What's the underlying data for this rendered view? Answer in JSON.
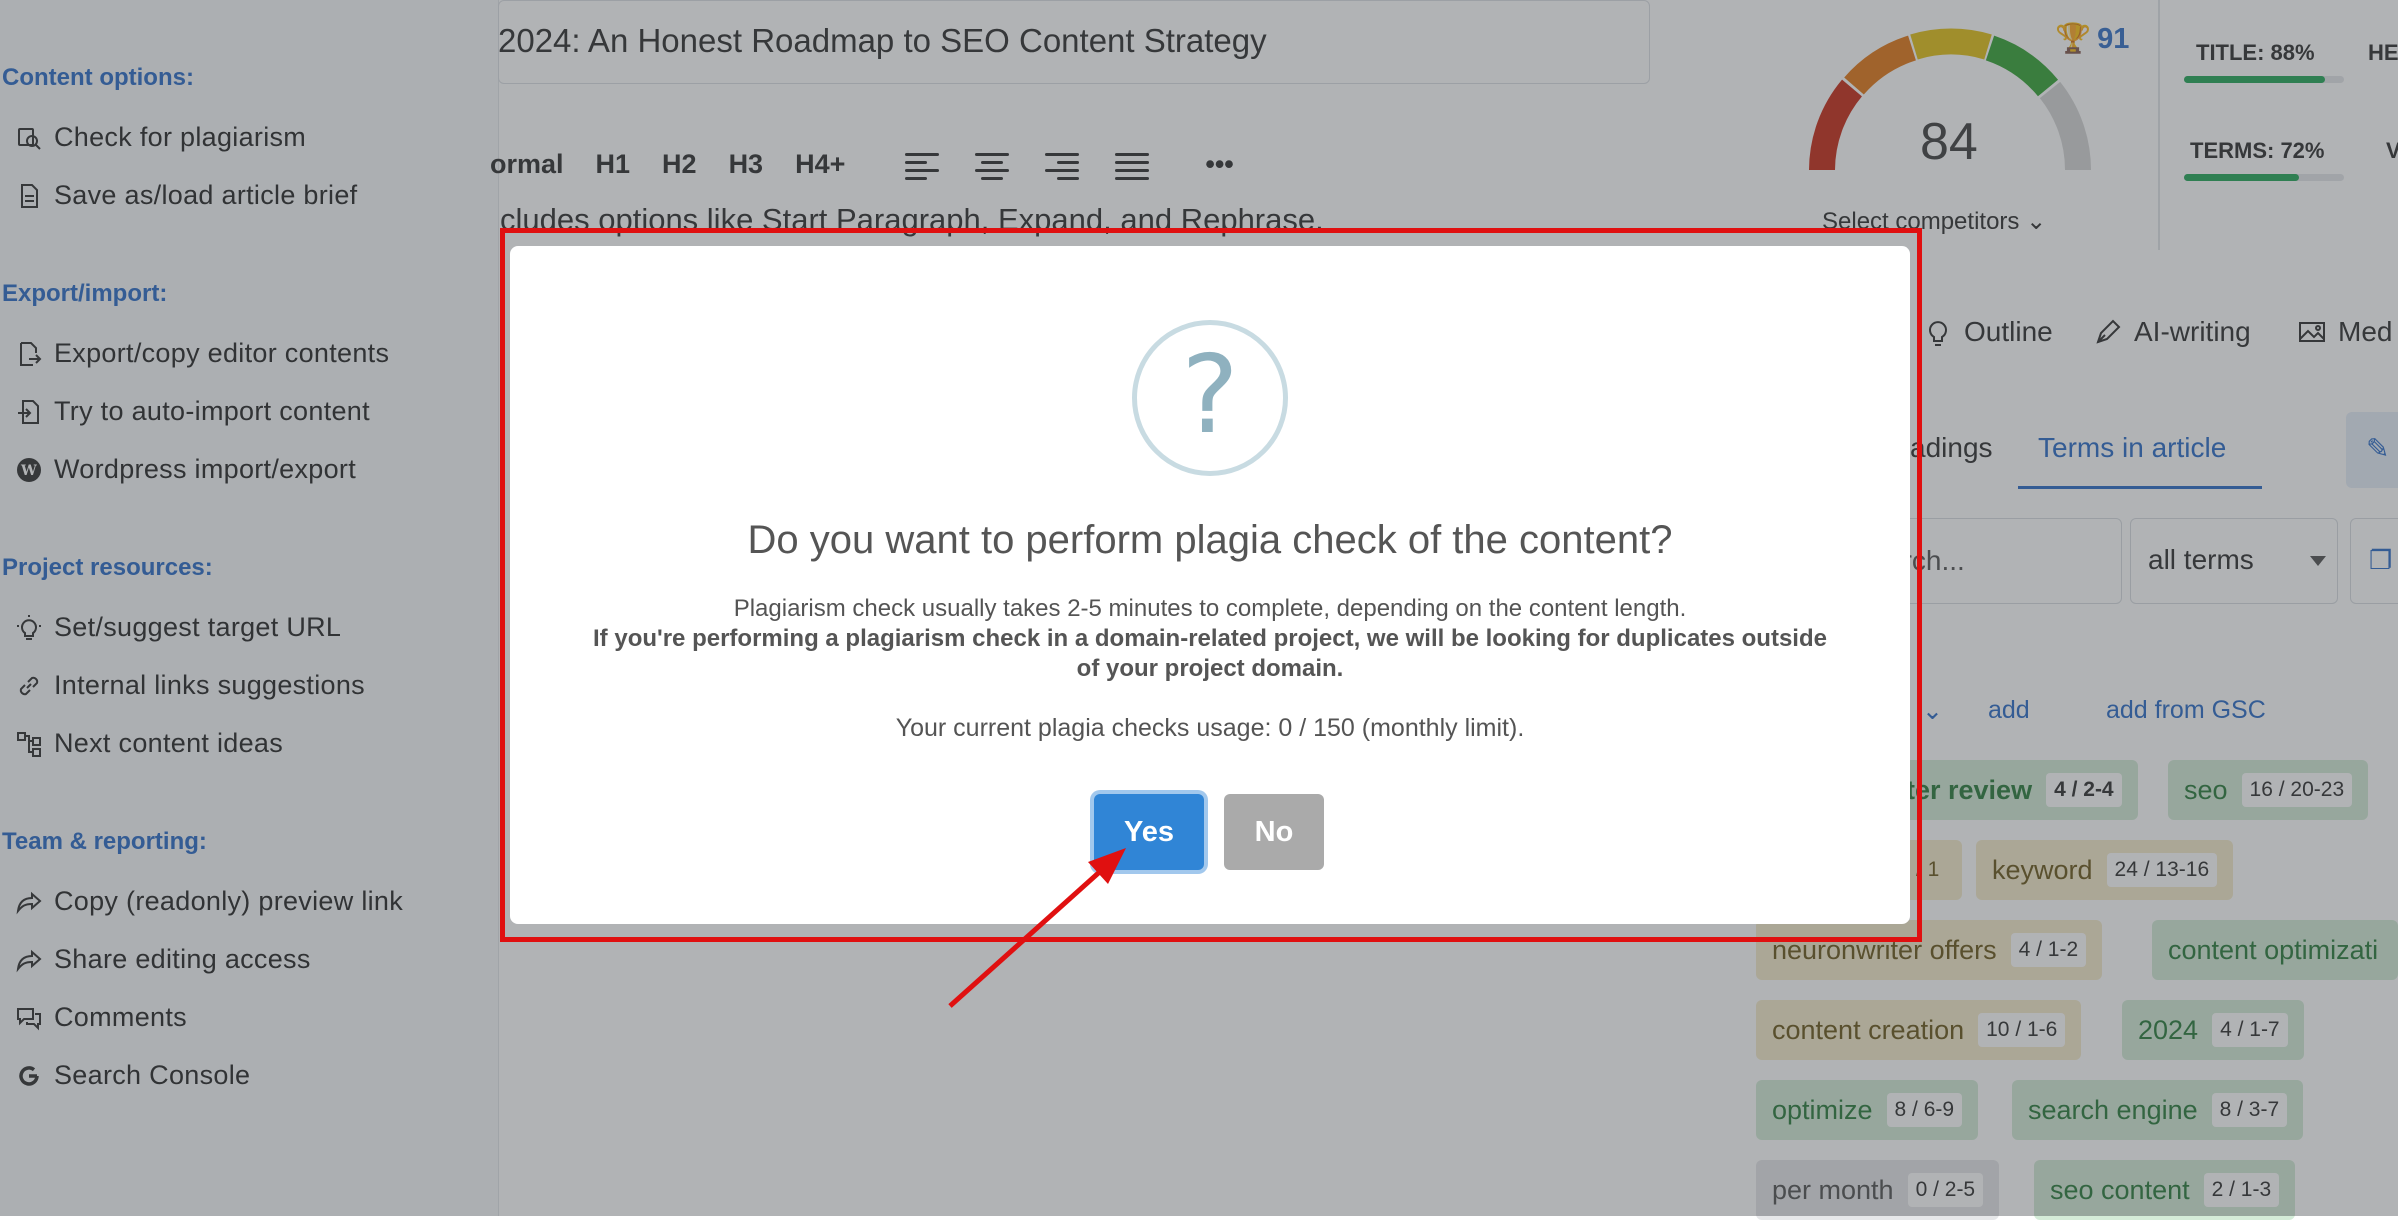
{
  "sidebar": {
    "sections": [
      {
        "heading": "Content options:",
        "items": [
          "Check for plagiarism",
          "Save as/load article brief"
        ]
      },
      {
        "heading": "Export/import:",
        "items": [
          "Export/copy editor contents",
          "Try to auto-import content",
          "Wordpress import/export"
        ]
      },
      {
        "heading": "Project resources:",
        "items": [
          "Set/suggest target URL",
          "Internal links suggestions",
          "Next content ideas"
        ]
      },
      {
        "heading": "Team & reporting:",
        "items": [
          "Copy (readonly) preview link",
          "Share editing access",
          "Comments",
          "Search Console"
        ]
      }
    ]
  },
  "editor": {
    "title": "2024: An Honest Roadmap to SEO Content Strategy",
    "toolbar": {
      "normal": "ormal",
      "h1": "H1",
      "h2": "H2",
      "h3": "H3",
      "h4": "H4+",
      "more": "•••"
    },
    "line": "cludes options like Start Paragraph, Expand, and Rephrase."
  },
  "score": {
    "value": "84",
    "trophy": "91",
    "select_competitors": "Select competitors",
    "title_metric": "TITLE: 88%",
    "title_pct": 88,
    "terms_metric": "TERMS: 72%",
    "terms_pct": 72,
    "he_metric": "HE",
    "v_metric": "V"
  },
  "panel": {
    "tabs": {
      "outline": "Outline",
      "ai_writing": "AI-writing",
      "media": "Med"
    },
    "subtabs": {
      "headings": "adings",
      "terms": "Terms in article"
    },
    "search_placeholder": "arch...",
    "filter_value": "all terms",
    "add": "add",
    "add_gsc": "add from GSC",
    "terms": [
      {
        "label": "ter review",
        "count": "4 / 2-4"
      },
      {
        "label": "seo",
        "count": "16 / 20-23"
      },
      {
        "label": "",
        "count": "/ 1"
      },
      {
        "label": "keyword",
        "count": "24 / 13-16"
      },
      {
        "label": "neuronwriter offers",
        "count": "4 / 1-2"
      },
      {
        "label": "content optimizati",
        "count": ""
      },
      {
        "label": "content creation",
        "count": "10 / 1-6"
      },
      {
        "label": "2024",
        "count": "4 / 1-7"
      },
      {
        "label": "optimize",
        "count": "8 / 6-9"
      },
      {
        "label": "search engine",
        "count": "8 / 3-7"
      },
      {
        "label": "per month",
        "count": "0 / 2-5"
      },
      {
        "label": "seo content",
        "count": "2 / 1-3"
      }
    ]
  },
  "modal": {
    "icon": "?",
    "title": "Do you want to perform plagia check of the content?",
    "body_line": "Plagiarism check usually takes 2-5 minutes to complete, depending on the content length.",
    "body_bold": "If you're performing a plagiarism check in a domain-related project, we will be looking for duplicates outside of your project domain.",
    "usage": "Your current plagia checks usage: 0 / 150 (monthly limit).",
    "yes": "Yes",
    "no": "No"
  },
  "colors": {
    "accent": "#3085d6",
    "highlight": "#e01010",
    "heading": "#2f6fc9",
    "term_green": "#2d7d3e"
  }
}
